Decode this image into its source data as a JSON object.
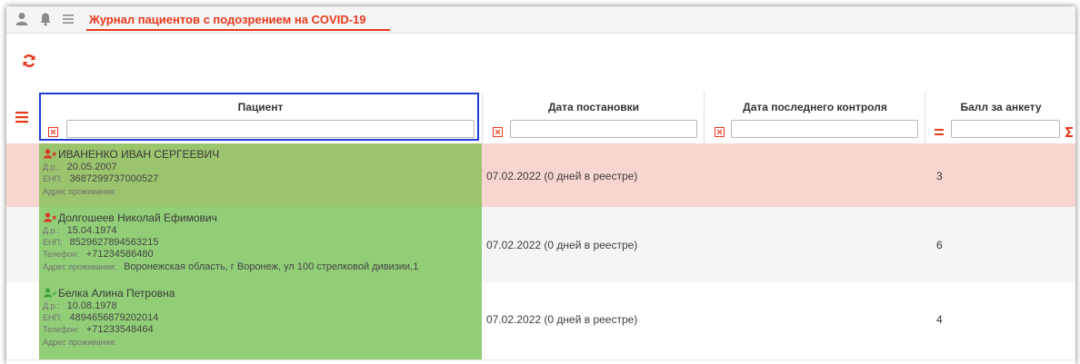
{
  "app": {
    "title": "Журнал пациентов с подозрением на COVID-19"
  },
  "colors": {
    "accent": "#e8391c",
    "focus_border": "#1f3fd8",
    "row_danger_bg": "#f8d5d0",
    "patient_cell_green": "#92ce78",
    "patient_cell_green_dark": "#9bc46e",
    "icon_red": "#d8352a",
    "icon_green": "#3fa33d"
  },
  "icons": {
    "user": "user-icon",
    "bell": "bell-icon",
    "menu": "hamburger-icon",
    "refresh": "refresh-icon",
    "clear_filter": "clear-filter-icon",
    "equals": "equals-icon",
    "sigma": "sigma-icon"
  },
  "columns": [
    {
      "key": "patient",
      "label": "Пациент",
      "filter_value": ""
    },
    {
      "key": "registration_date",
      "label": "Дата постановки",
      "filter_value": ""
    },
    {
      "key": "last_control_date",
      "label": "Дата последнего контроля",
      "filter_value": ""
    },
    {
      "key": "questionnaire_score",
      "label": "Балл за анкету",
      "filter_value": ""
    }
  ],
  "field_labels": {
    "dob": "Д.р.:",
    "enp": "ЕНП:",
    "phone": "Телефон:",
    "address": "Адрес проживания:"
  },
  "rows": [
    {
      "name": "ИВАНЕНКО ИВАН СЕРГЕЕВИЧ",
      "status_icon": "user-remove-icon",
      "dob": "20.05.2007",
      "enp": "3687299737000527",
      "phone": "",
      "address": "",
      "registration": "07.02.2022 (0 дней в реестре)",
      "last_control": "",
      "score": "3"
    },
    {
      "name": "Долгошеев Николай Ефимович",
      "status_icon": "user-remove-icon",
      "dob": "15.04.1974",
      "enp": "8529627894563215",
      "phone": "+71234586480",
      "address": "Воронежская область, г Воронеж, ул 100 стрелковой дивизии,1",
      "registration": "07.02.2022 (0 дней в реестре)",
      "last_control": "",
      "score": "6"
    },
    {
      "name": "Белка Алина Петровна",
      "status_icon": "user-check-icon",
      "dob": "10.08.1978",
      "enp": "4894656879202014",
      "phone": "+71233548464",
      "address": "",
      "registration": "07.02.2022 (0 дней в реестре)",
      "last_control": "",
      "score": "4"
    }
  ]
}
